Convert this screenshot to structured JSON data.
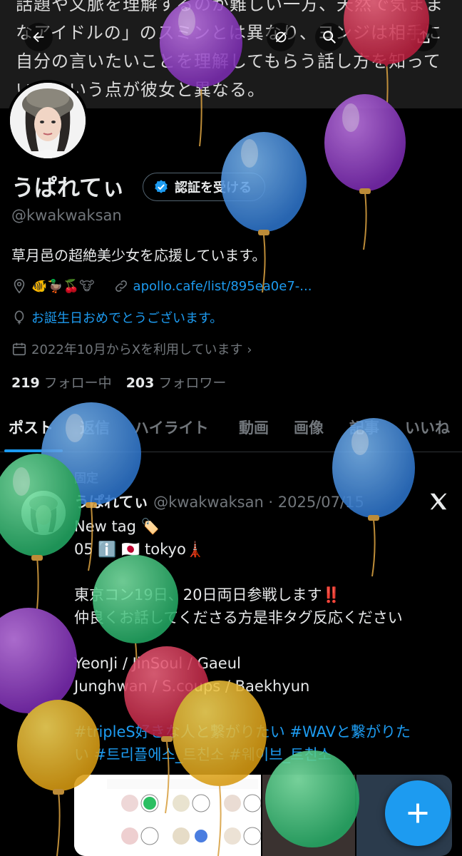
{
  "banner": {
    "text": "話題や文脈を理解するのが難しい一方、天然で気ままなアイドルの」のスミンとは異なり、ヨンジは相手に自分の言いたいことを理解してもらう話し方を知っているという点が彼女と異なる。"
  },
  "nav": {
    "back_icon": "back-arrow-icon",
    "grok_icon": "grok-icon",
    "search_icon": "search-icon",
    "share_icon": "share-icon"
  },
  "profile": {
    "display_name": "うぱれてぃ",
    "verify_label": "認証を受ける",
    "handle": "@kwakwaksan",
    "bio": "草月邑の超絶美少女を応援しています。",
    "location_emojis": "🐠🦆🍒🐮",
    "link": "apollo.cafe/list/895ea0e7-...",
    "birthday": "お誕生日おめでとうございます。",
    "joined": "2022年10月からXを利用しています ›",
    "following_count": "219",
    "following_label": "フォロー中",
    "followers_count": "203",
    "followers_label": "フォロワー"
  },
  "tabs": [
    "ポスト",
    "返信",
    "ハイライト",
    "動画",
    "画像",
    "記事",
    "いいね"
  ],
  "post": {
    "pinned_label": "固定",
    "author_name": "うぱれてぃ",
    "author_handle": "@kwakwaksan · 2025/07/15",
    "line1": "New tag 🏷️",
    "line2": "05 ℹ️ 🇯🇵 tokyo🗼",
    "line3": "東京コン19日、20日両日参戦します‼️",
    "line4": "仲良くお話してくださる方是非タグ反応ください",
    "line5": "YeonJi / JinSoul / Gaeul",
    "line6": "Junghwan / S.coups / Baekhyun",
    "hashtags1": "#tripleS好きな人と繋がりたい #WAVと繋がりた",
    "hashtags2": "い #트리플에스_트친소 #웨이브_트친소"
  },
  "colors": {
    "accent": "#1d9bf0",
    "background": "#000000",
    "secondary_text": "#71767b"
  }
}
